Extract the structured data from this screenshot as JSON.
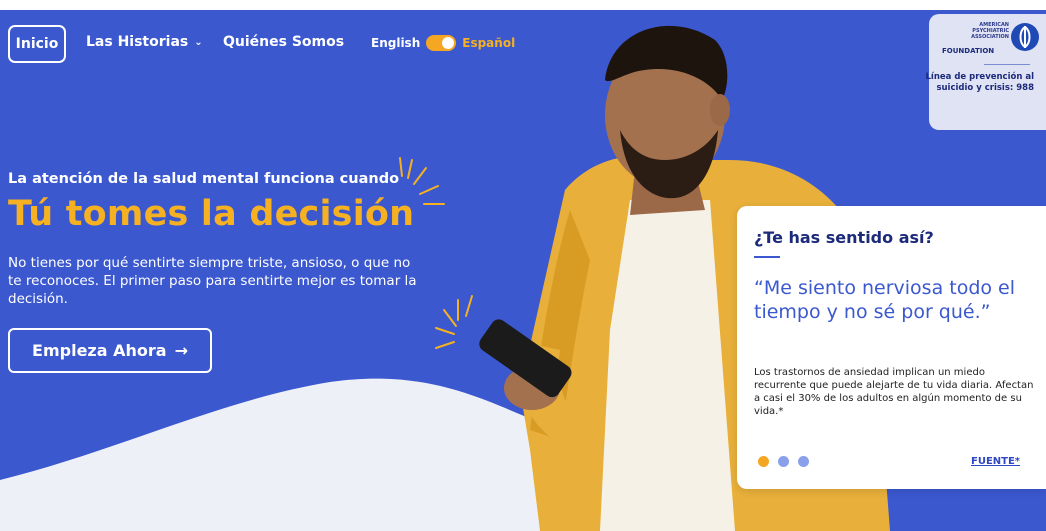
{
  "nav": {
    "home_label": "Inicio",
    "stories_label": "Las Historias",
    "about_label": "Quiénes Somos",
    "lang_en": "English",
    "lang_es": "Español",
    "language_toggle_on": true
  },
  "hero": {
    "eyebrow": "La atención de la salud mental funciona cuando",
    "headline": "Tú tomes la decisión",
    "body": "No tienes por qué sentirte siempre triste, ansioso, o que no te reconoces. El primer paso para sentirte mejor es tomar la decisión.",
    "cta_label": "Empleza Ahora",
    "cta_icon": "→"
  },
  "logo": {
    "small_text": "AMERICAN PSYCHIATRIC ASSOCIATION",
    "foundation": "FOUNDATION",
    "crisis": "Línea de prevención al suicidio y crisis: 988"
  },
  "card": {
    "title": "¿Te has sentido así?",
    "quote": "“Me siento nerviosa todo el tiempo y no sé por qué.”",
    "body": "Los trastornos de ansiedad implican un miedo recurrente que puede alejarte de tu vida diaria. Afectan a casi el 30% de los adultos en algún momento de su vida.*",
    "source_label": "FUENTE*",
    "dots": [
      "active",
      "inactive",
      "inactive"
    ]
  },
  "colors": {
    "brand_blue": "#3b58cf",
    "accent_yellow": "#f5b122",
    "dot_active": "#f5a623",
    "dot_inactive": "#8aa0ea"
  }
}
